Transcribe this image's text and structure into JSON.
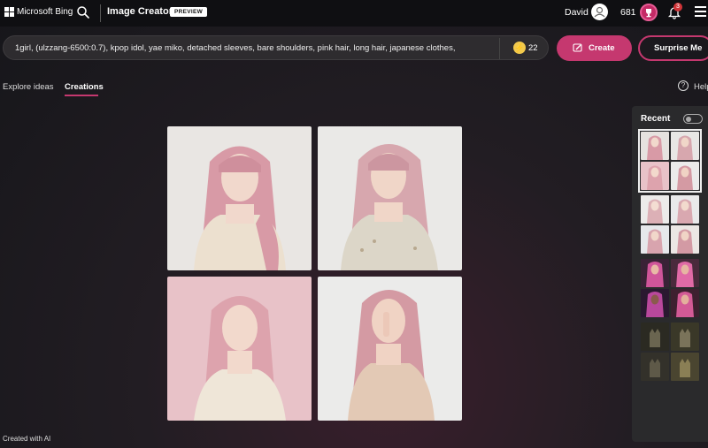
{
  "header": {
    "brand": "Microsoft Bing",
    "app_title": "Image Creator",
    "badge": "PREVIEW",
    "user_name": "David",
    "points": "681",
    "notification_count": "3"
  },
  "prompt": {
    "text": "1girl, (ulzzang-6500:0.7), kpop idol, yae miko, detached sleeves, bare shoulders, pink hair, long hair, japanese clothes,",
    "boosts": "22"
  },
  "actions": {
    "create": "Create",
    "surprise": "Surprise Me"
  },
  "tabs": [
    "Explore ideas",
    "Creations"
  ],
  "active_tab": "Creations",
  "help_label": "Help",
  "recent": {
    "title": "Recent",
    "groups": [
      {
        "theme": "pink-hair-portraits",
        "selected": true
      },
      {
        "theme": "pink-hair-portraits-light",
        "selected": false
      },
      {
        "theme": "fantasy-pink-warriors",
        "selected": false
      },
      {
        "theme": "dark-cat-illustrations",
        "selected": false
      }
    ]
  },
  "footer": {
    "credit": "Created with AI"
  },
  "colors": {
    "accent": "#c5386f",
    "panel": "#2a2a2c",
    "topbar": "#0f0f12"
  },
  "icons": [
    "microsoft-logo-icon",
    "search-icon",
    "avatar-icon",
    "rewards-icon",
    "bell-icon",
    "menu-icon",
    "boost-icon",
    "create-icon",
    "help-icon",
    "toggle-icon"
  ]
}
